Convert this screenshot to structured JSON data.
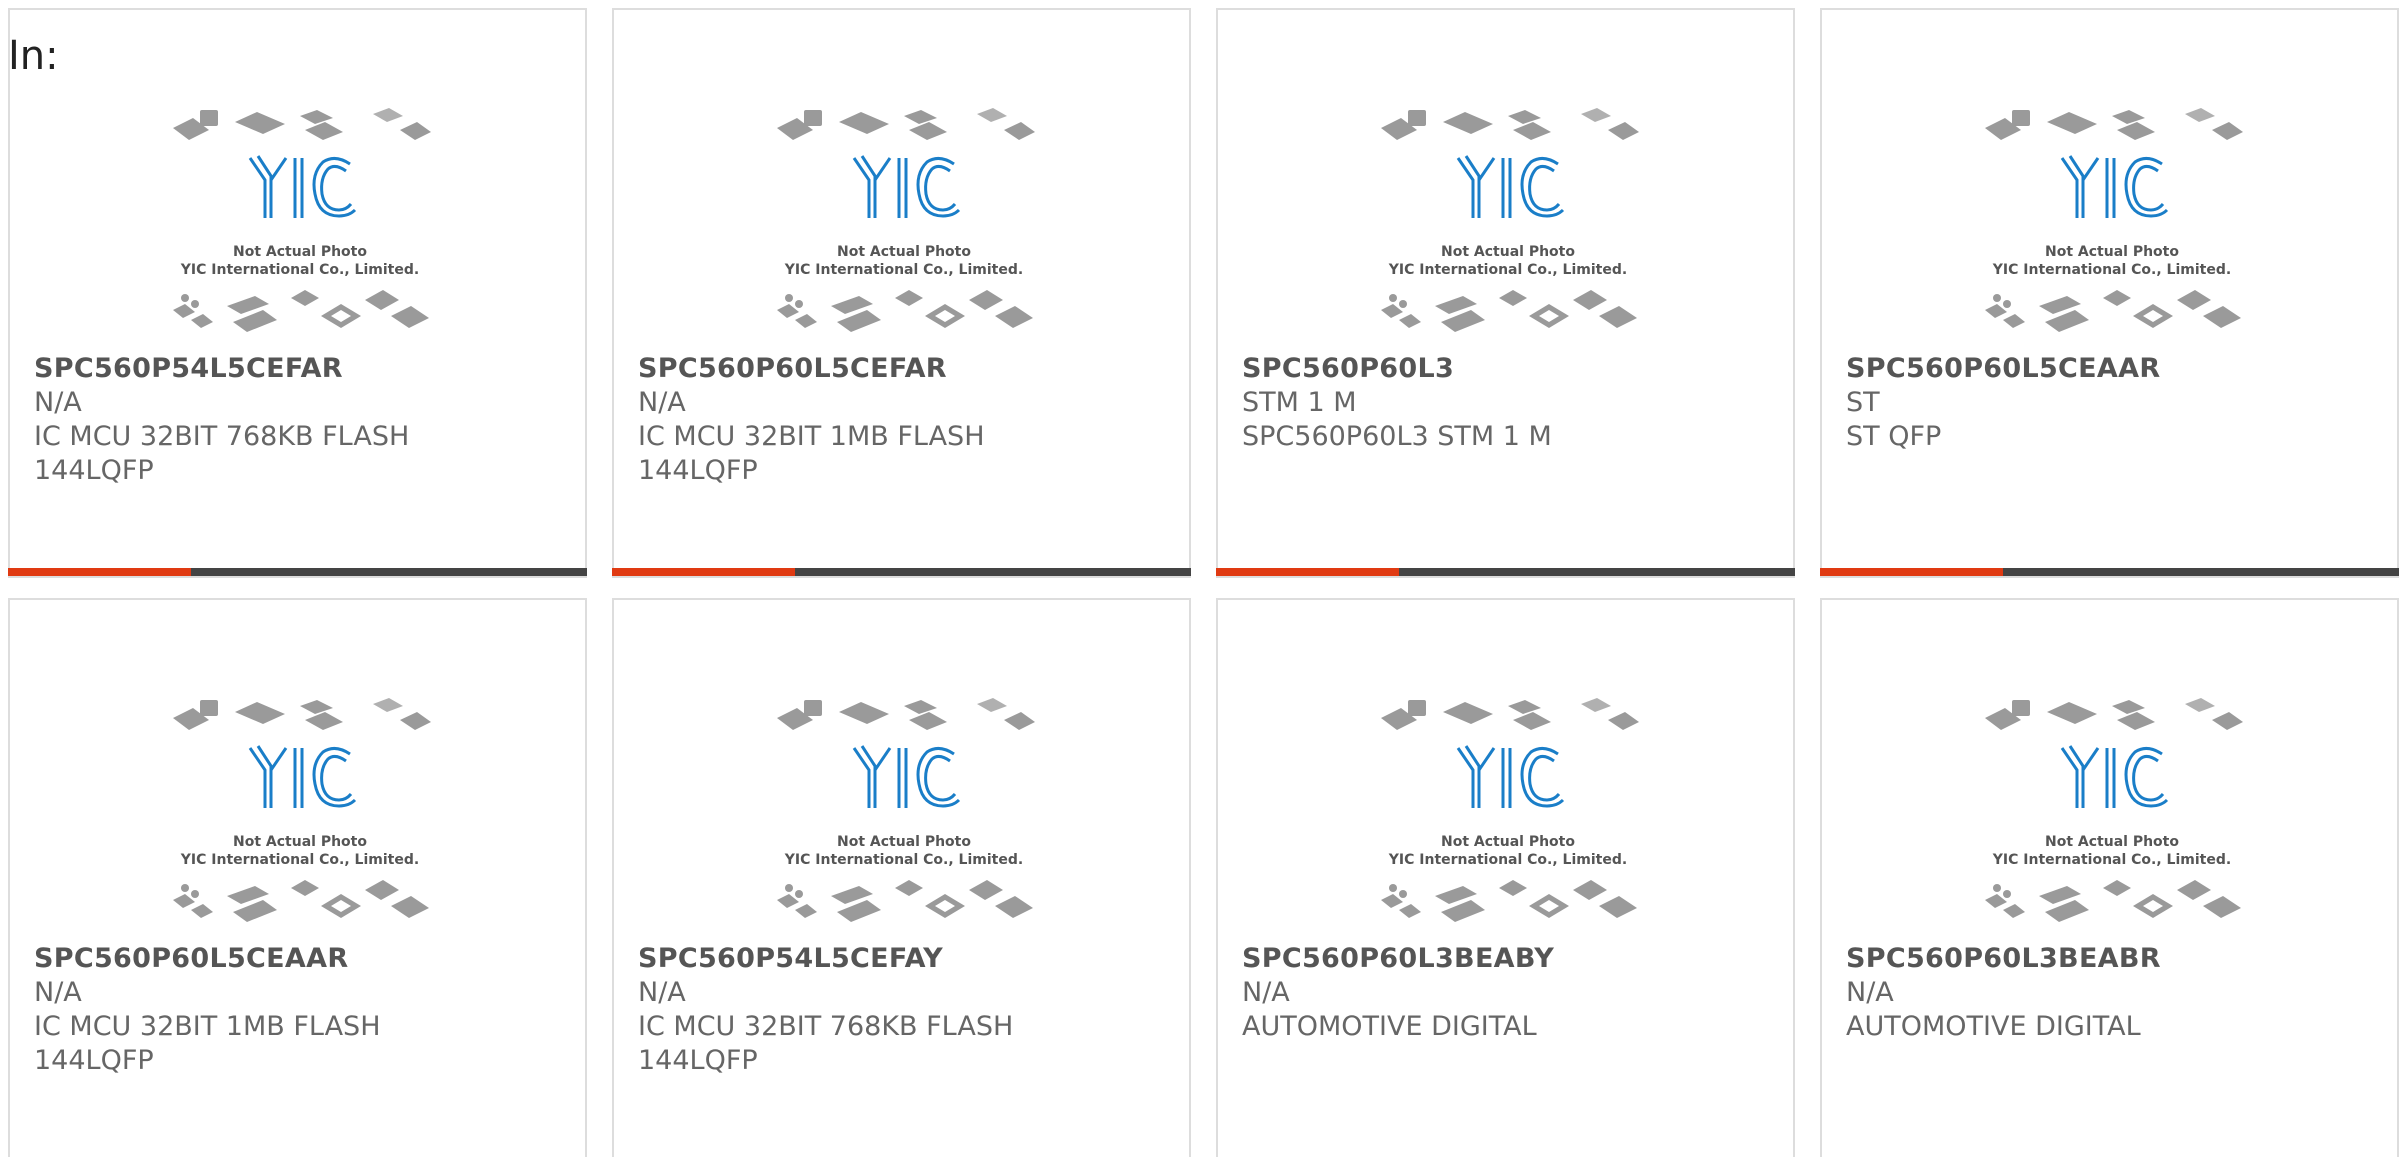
{
  "header": {
    "label": "In:"
  },
  "placeholder_image": {
    "line1": "Not Actual Photo",
    "line2": "YIC International Co., Limited.",
    "logo_text": "YIC"
  },
  "colors": {
    "accent": "#e03a12",
    "bar": "#444444",
    "logo_blue": "#1a7ec8",
    "chip_gray": "#9a9a9a"
  },
  "products": [
    {
      "part_number": "SPC560P54L5CEFAR",
      "manufacturer": "N/A",
      "description": "IC MCU 32BIT 768KB FLASH\n144LQFP"
    },
    {
      "part_number": "SPC560P60L5CEFAR",
      "manufacturer": "N/A",
      "description": "IC MCU 32BIT 1MB FLASH\n144LQFP"
    },
    {
      "part_number": "SPC560P60L3",
      "manufacturer": "STM 1 M",
      "description": "SPC560P60L3 STM 1 M"
    },
    {
      "part_number": "SPC560P60L5CEAAR",
      "manufacturer": "ST",
      "description": "ST QFP"
    },
    {
      "part_number": "SPC560P60L5CEAAR",
      "manufacturer": "N/A",
      "description": "IC MCU 32BIT 1MB FLASH\n144LQFP"
    },
    {
      "part_number": "SPC560P54L5CEFAY",
      "manufacturer": "N/A",
      "description": "IC MCU 32BIT 768KB FLASH\n144LQFP"
    },
    {
      "part_number": "SPC560P60L3BEABY",
      "manufacturer": "N/A",
      "description": "AUTOMOTIVE DIGITAL"
    },
    {
      "part_number": "SPC560P60L3BEABR",
      "manufacturer": "N/A",
      "description": "AUTOMOTIVE DIGITAL"
    }
  ]
}
